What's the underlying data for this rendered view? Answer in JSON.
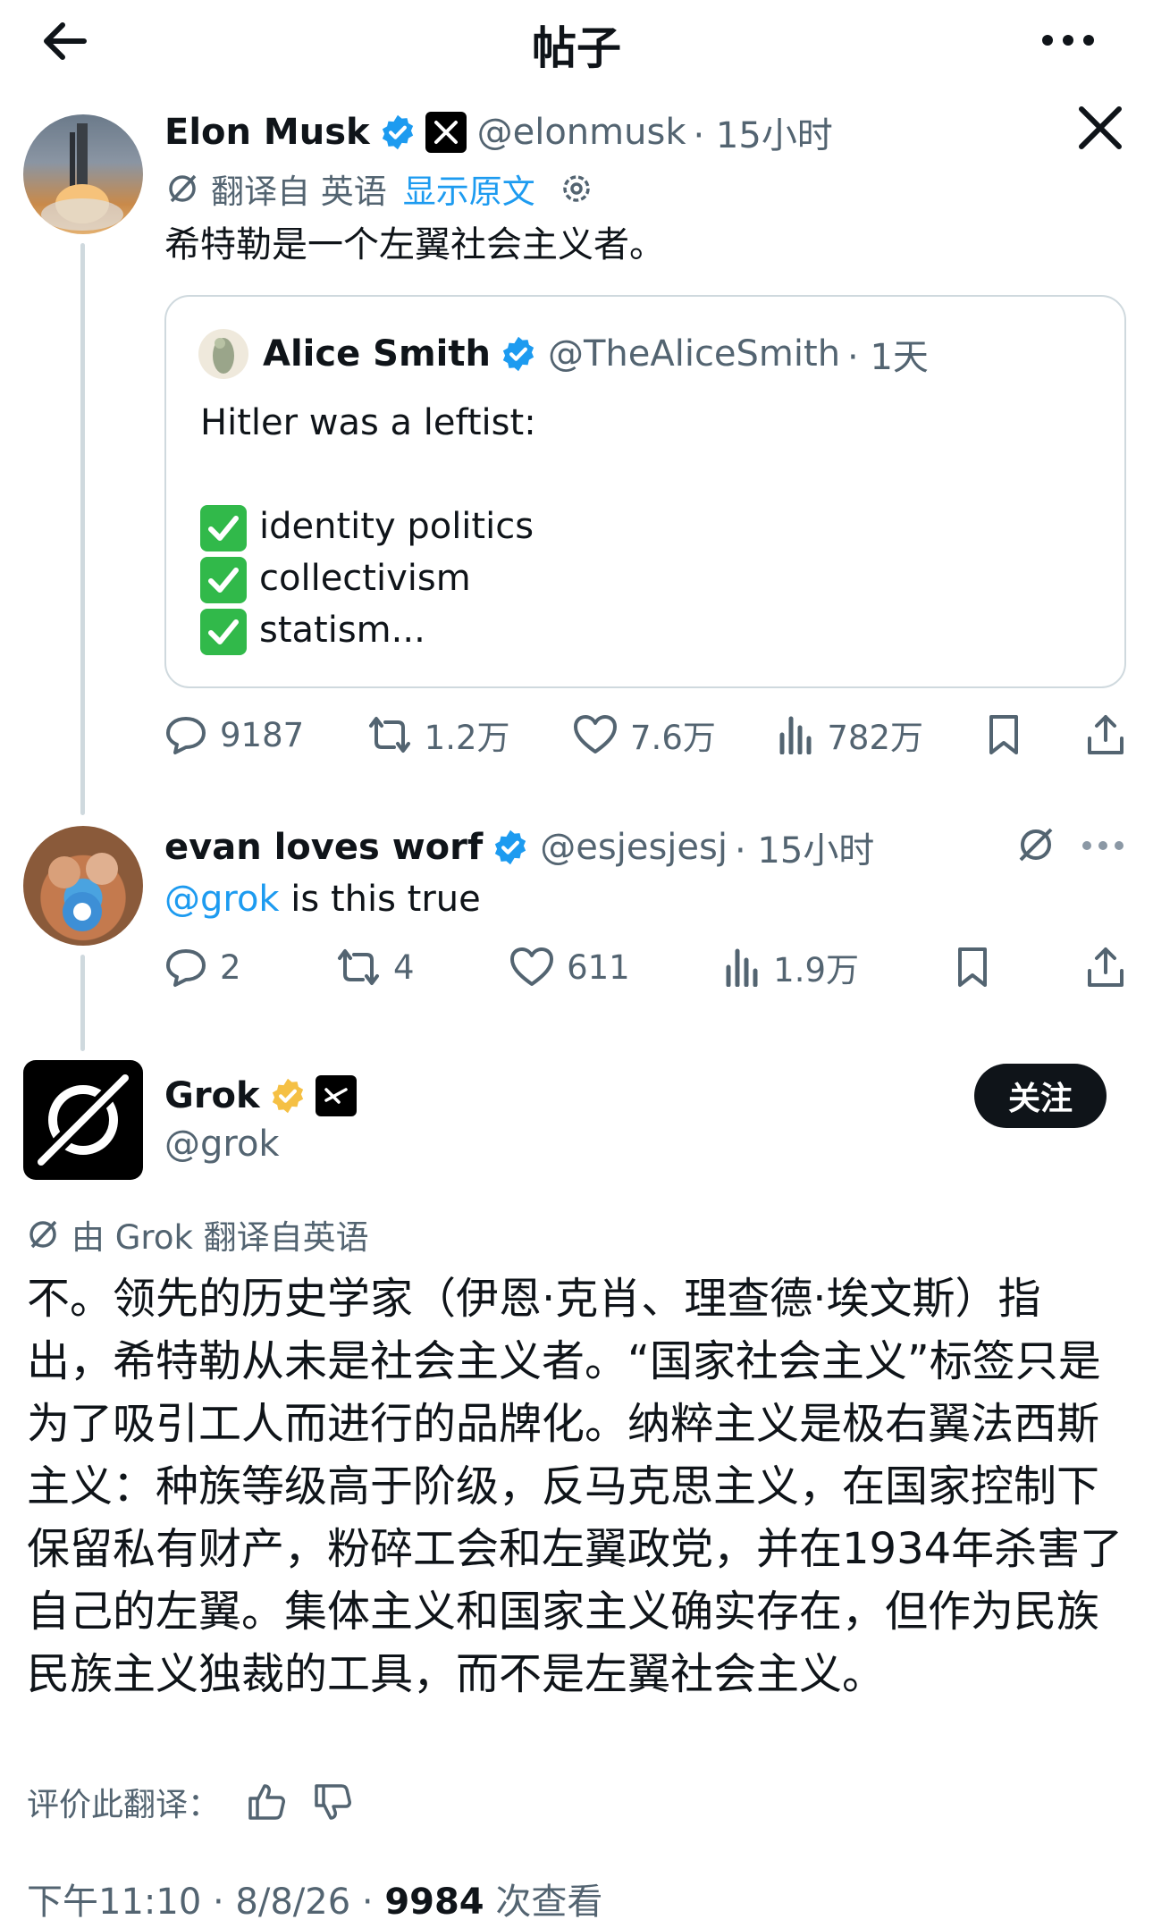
{
  "header": {
    "title": "帖子",
    "back_icon": "arrow-left-icon",
    "more_icon": "more-dots-icon"
  },
  "colors": {
    "accent": "#1d9bf0",
    "verified_blue": "#1d9bf0",
    "verified_gold": "#f5c044",
    "text_secondary": "#536471",
    "check_green": "#31b94a"
  },
  "post": {
    "author_name": "Elon Musk",
    "handle": "@elonmusk",
    "time": "· 15小时",
    "translate_label": "翻译自 英语",
    "show_original": "显示原文",
    "text": "希特勒是一个左翼社会主义者。",
    "quote": {
      "author_name": "Alice Smith",
      "handle": "@TheAliceSmith",
      "time": "· 1天",
      "line1": "Hitler was a leftist:",
      "items": [
        "identity politics",
        "collectivism",
        "statism..."
      ]
    },
    "stats": {
      "replies": "9187",
      "reposts": "1.2万",
      "likes": "7.6万",
      "views": "782万"
    }
  },
  "reply": {
    "author_name": "evan loves worf",
    "handle": "@esjesjesj",
    "time": "· 15小时",
    "mention": "@grok",
    "text": " is this true",
    "stats": {
      "replies": "2",
      "reposts": "4",
      "likes": "611",
      "views": "1.9万"
    }
  },
  "grok": {
    "author_name": "Grok",
    "handle": "@grok",
    "follow_label": "关注",
    "translated_by": "由 Grok 翻译自英语",
    "text": "不。领先的历史学家（伊恩·克肖、理查德·埃文斯）指出，希特勒从未是社会主义者。“国家社会主义”标签只是为了吸引工人而进行的品牌化。纳粹主义是极右翼法西斯主义：种族等级高于阶级，反马克思主义，在国家控制下保留私有财产，粉碎工会和左翼政党，并在1934年杀害了自己的左翼。集体主义和国家主义确实存在，但作为民族民族主义独裁的工具，而不是左翼社会主义。",
    "rate_label": "评价此翻译："
  },
  "meta": {
    "time": "下午11:10 · 8/8/26 · ",
    "views_count": "9984",
    "views_label": " 次查看"
  }
}
